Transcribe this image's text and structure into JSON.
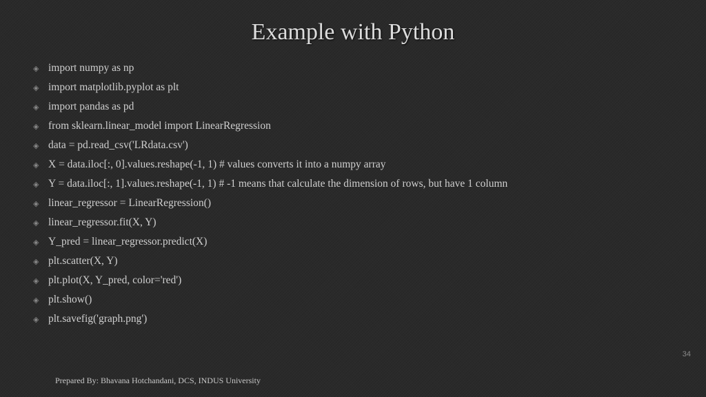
{
  "title": "Example with Python",
  "bullets": [
    "import numpy as np",
    "import matplotlib.pyplot as plt",
    "import pandas as pd",
    "from sklearn.linear_model import LinearRegression",
    "data = pd.read_csv('LRdata.csv')",
    "X = data.iloc[:, 0].values.reshape(-1, 1) # values converts it into a numpy array",
    "Y = data.iloc[:, 1].values.reshape(-1, 1) # -1 means that calculate the dimension of rows, but have 1 column",
    "linear_regressor = LinearRegression()",
    "linear_regressor.fit(X, Y)",
    "Y_pred = linear_regressor.predict(X)",
    "plt.scatter(X, Y)",
    "plt.plot(X, Y_pred, color='red')",
    "plt.show()",
    "plt.savefig('graph.png')"
  ],
  "page_number": "34",
  "footer": "Prepared By: Bhavana Hotchandani, DCS, INDUS University"
}
